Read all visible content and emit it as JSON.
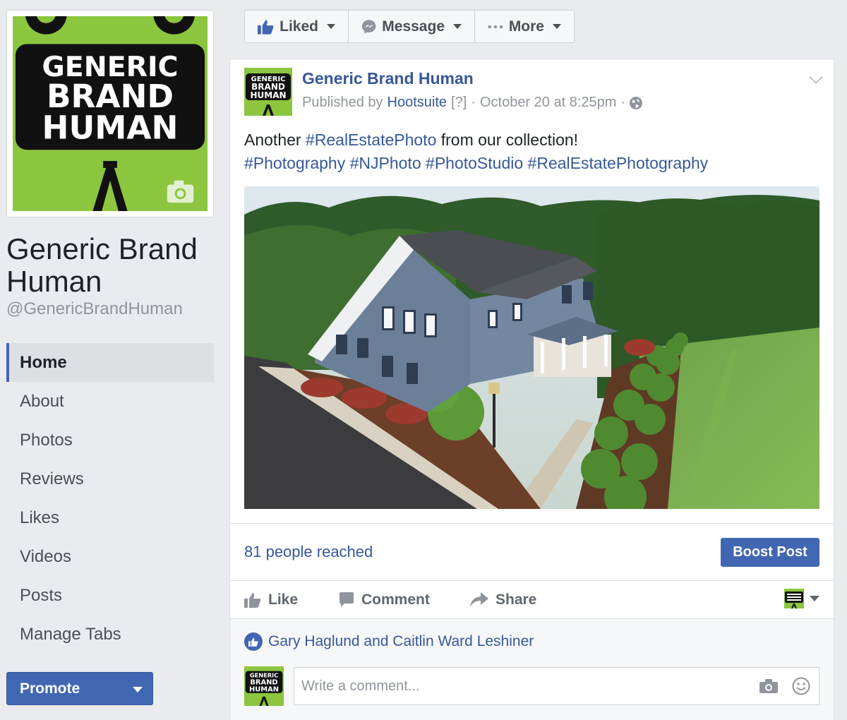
{
  "sidebar": {
    "logo_text": [
      "GENERIC",
      "BRAND",
      "HUMAN"
    ],
    "page_name": "Generic Brand Human",
    "handle": "@GenericBrandHuman",
    "nav": [
      "Home",
      "About",
      "Photos",
      "Reviews",
      "Likes",
      "Videos",
      "Posts",
      "Manage Tabs"
    ],
    "promote_label": "Promote"
  },
  "actions": {
    "liked": "Liked",
    "message": "Message",
    "more": "More"
  },
  "post": {
    "author": "Generic Brand Human",
    "published_by": "Published by",
    "publisher": "Hootsuite",
    "help": "[?]",
    "separator": "·",
    "timestamp": "October 20 at 8:25pm",
    "text_prefix": "Another",
    "hashtag_1": "#RealEstatePhoto",
    "text_suffix": "from our collection!",
    "hashtags_line": [
      "#Photography",
      "#NJPhoto",
      "#PhotoStudio",
      "#RealEstatePhotography"
    ],
    "reached": "81 people reached",
    "boost": "Boost Post",
    "like": "Like",
    "comment": "Comment",
    "share": "Share",
    "likers": "Gary Haglund and Caitlin Ward Leshiner",
    "comment_placeholder": "Write a comment..."
  },
  "colors": {
    "brand_green": "#8cc63f",
    "fb_blue": "#4267b2",
    "link_blue": "#365899"
  },
  "icons": [
    "thumbs-up-icon",
    "messenger-icon",
    "more-dots-icon",
    "camera-icon",
    "globe-icon",
    "chevron-down-icon",
    "comment-icon",
    "share-icon",
    "smiley-icon"
  ]
}
